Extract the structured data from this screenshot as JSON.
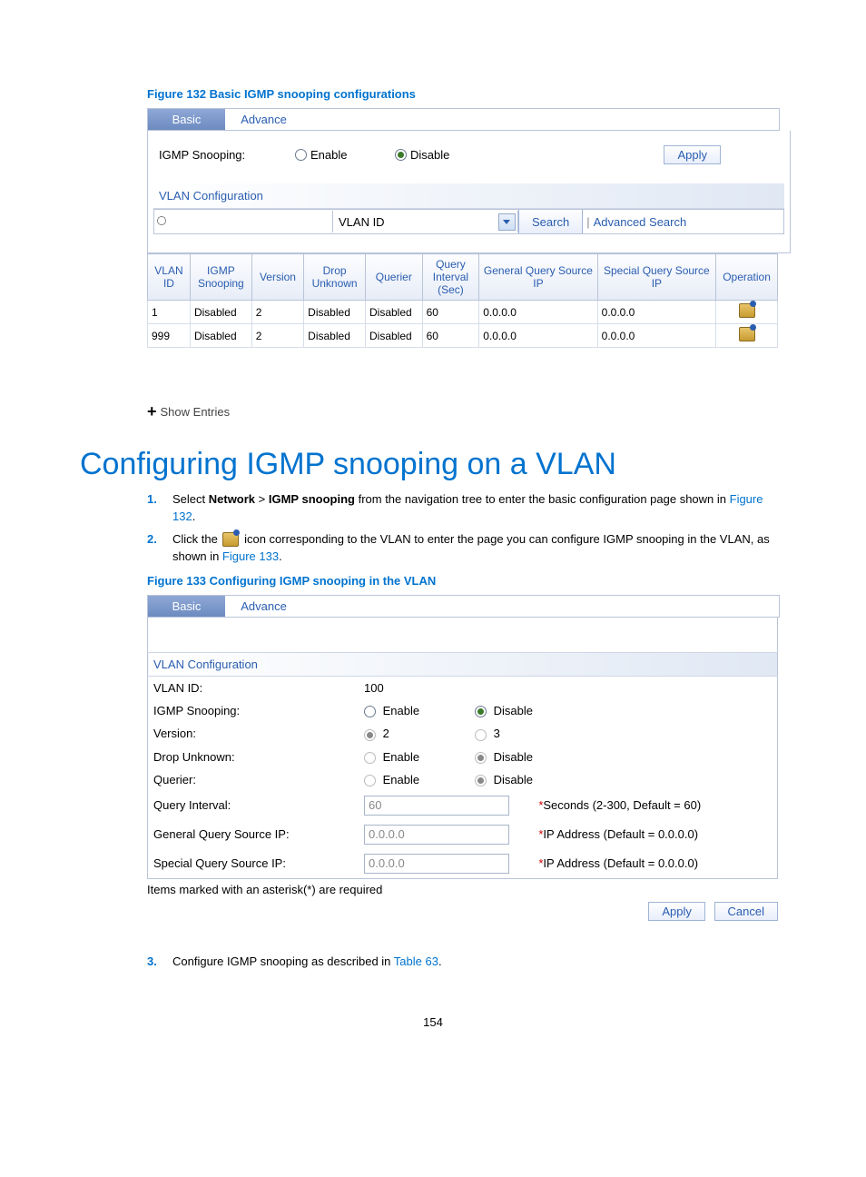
{
  "figure132": {
    "caption": "Figure 132 Basic IGMP snooping configurations",
    "tabs": {
      "basic": "Basic",
      "advance": "Advance"
    },
    "igmp_label": "IGMP Snooping:",
    "enable": "Enable",
    "disable": "Disable",
    "apply": "Apply",
    "vlan_config_title": "VLAN Configuration",
    "dropdown_value": "VLAN ID",
    "search": "Search",
    "adv_search": "Advanced Search",
    "headers": [
      "VLAN ID",
      "IGMP Snooping",
      "Version",
      "Drop Unknown",
      "Querier",
      "Query Interval (Sec)",
      "General Query Source IP",
      "Special Query Source IP",
      "Operation"
    ],
    "rows": [
      {
        "vlan": "1",
        "snoop": "Disabled",
        "ver": "2",
        "drop": "Disabled",
        "querier": "Disabled",
        "interval": "60",
        "gq": "0.0.0.0",
        "sq": "0.0.0.0"
      },
      {
        "vlan": "999",
        "snoop": "Disabled",
        "ver": "2",
        "drop": "Disabled",
        "querier": "Disabled",
        "interval": "60",
        "gq": "0.0.0.0",
        "sq": "0.0.0.0"
      }
    ],
    "show_entries": "Show Entries"
  },
  "heading": "Configuring IGMP snooping on a VLAN",
  "steps": {
    "s1_a": "Select ",
    "s1_network": "Network",
    "s1_gt": " > ",
    "s1_igmp": "IGMP snooping",
    "s1_b": " from the navigation tree to enter the basic configuration page shown in ",
    "s1_link": "Figure 132",
    "s1_c": ".",
    "s2_a": "Click the ",
    "s2_b": " icon corresponding to the VLAN to enter the page you can configure IGMP snooping in the VLAN, as shown in ",
    "s2_link": "Figure 133",
    "s2_c": ".",
    "s3_a": "Configure IGMP snooping as described in ",
    "s3_link": "Table 63",
    "s3_b": "."
  },
  "figure133": {
    "caption": "Figure 133 Configuring IGMP snooping in the VLAN",
    "tabs": {
      "basic": "Basic",
      "advance": "Advance"
    },
    "vlan_config_title": "VLAN Configuration",
    "form": {
      "vlan_id_label": "VLAN ID:",
      "vlan_id_value": "100",
      "snoop_label": "IGMP Snooping:",
      "enable": "Enable",
      "disable": "Disable",
      "version_label": "Version:",
      "v2": "2",
      "v3": "3",
      "drop_label": "Drop Unknown:",
      "querier_label": "Querier:",
      "qinterval_label": "Query Interval:",
      "qinterval_value": "60",
      "qinterval_hint": "Seconds (2-300, Default = 60)",
      "gq_label": "General Query Source IP:",
      "gq_value": "0.0.0.0",
      "gq_hint": "IP Address (Default = 0.0.0.0)",
      "sq_label": "Special Query Source IP:",
      "sq_value": "0.0.0.0",
      "sq_hint": "IP Address (Default = 0.0.0.0)"
    },
    "note": "Items marked with an asterisk(*) are required",
    "apply": "Apply",
    "cancel": "Cancel"
  },
  "page_number": "154"
}
